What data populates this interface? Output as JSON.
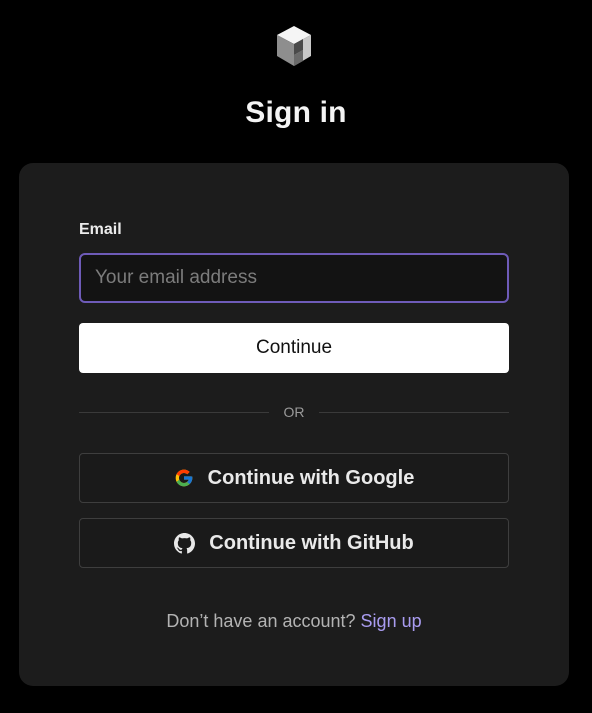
{
  "header": {
    "logo_icon": "cube-logo-icon",
    "title": "Sign in"
  },
  "form": {
    "email_label": "Email",
    "email_value": "",
    "email_placeholder": "Your email address",
    "continue_label": "Continue",
    "divider_text": "OR",
    "google_label": "Continue with Google",
    "google_icon": "google-icon",
    "github_label": "Continue with GitHub",
    "github_icon": "github-icon"
  },
  "footer": {
    "prompt": "Don’t have an account?",
    "signup_link": "Sign up"
  },
  "colors": {
    "background": "#000000",
    "card": "#1c1c1c",
    "input_focus_border": "#6e5bb8",
    "link": "#a99cf0"
  }
}
